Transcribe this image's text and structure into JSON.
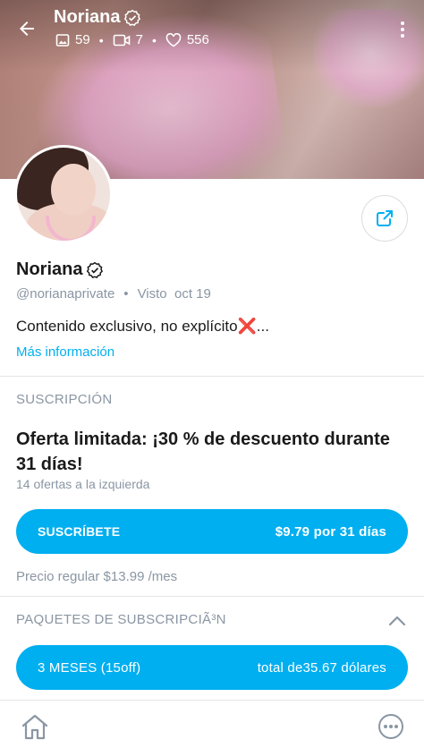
{
  "header": {
    "title": "Noriana",
    "stats": {
      "photos": "59",
      "videos": "7",
      "likes": "556"
    },
    "icons": [
      "back-arrow-icon",
      "verified-icon",
      "image-icon",
      "video-icon",
      "heart-icon",
      "more-vertical-icon"
    ]
  },
  "profile": {
    "name": "Noriana",
    "handle": "@norianaprivate",
    "last_seen": "Visto  oct 19",
    "bio_text": "Contenido exclusivo, no explícito",
    "bio_mark": "❌",
    "bio_ellipsis": "...",
    "more_info": "Más información"
  },
  "subscription": {
    "section_label": "SUSCRIPCIÓN",
    "offer_title": "Oferta limitada: ¡30 % de descuento durante 31 días!",
    "offer_sub": "14 ofertas a la izquierda",
    "subscribe_label": "SUSCRÍBETE",
    "subscribe_price": "$9.79 por 31 días",
    "regular_price": "Precio regular $13.99 /mes"
  },
  "bundles": {
    "section_label": "PAQUETES DE SUBSCRIPCIÃ³N",
    "items": [
      {
        "label": "3 MESES (15off)",
        "price": "total de35.67 dólares"
      }
    ]
  },
  "colors": {
    "accent": "#00aff0",
    "muted": "#8a96a3",
    "danger": "#e0202a"
  }
}
